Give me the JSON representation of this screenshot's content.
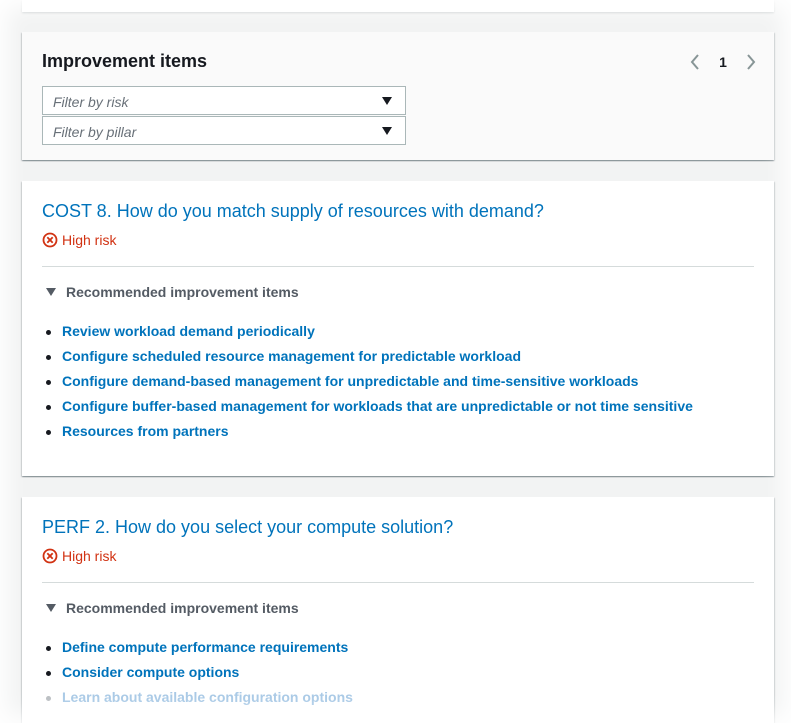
{
  "header": {
    "title": "Improvement items",
    "pagination": {
      "current_page": "1",
      "prev_icon": "chevron-left-icon",
      "next_icon": "chevron-right-icon"
    },
    "filters": [
      {
        "placeholder": "Filter by risk"
      },
      {
        "placeholder": "Filter by pillar"
      }
    ]
  },
  "questions": [
    {
      "title": "COST 8. How do you match supply of resources with demand?",
      "risk_label": "High risk",
      "risk_color": "#d13212",
      "section_label": "Recommended improvement items",
      "items": [
        "Review workload demand periodically",
        "Configure scheduled resource management for predictable workload",
        "Configure demand-based management for unpredictable and time-sensitive workloads",
        "Configure buffer-based management for workloads that are unpredictable or not time sensitive",
        "Resources from partners"
      ]
    },
    {
      "title": "PERF 2. How do you select your compute solution?",
      "risk_label": "High risk",
      "risk_color": "#d13212",
      "section_label": "Recommended improvement items",
      "items": [
        "Define compute performance requirements",
        "Consider compute options",
        "Learn about available configuration options"
      ]
    }
  ],
  "colors": {
    "link": "#0073bb",
    "risk": "#d13212",
    "text": "#16191f",
    "muted": "#687078"
  }
}
